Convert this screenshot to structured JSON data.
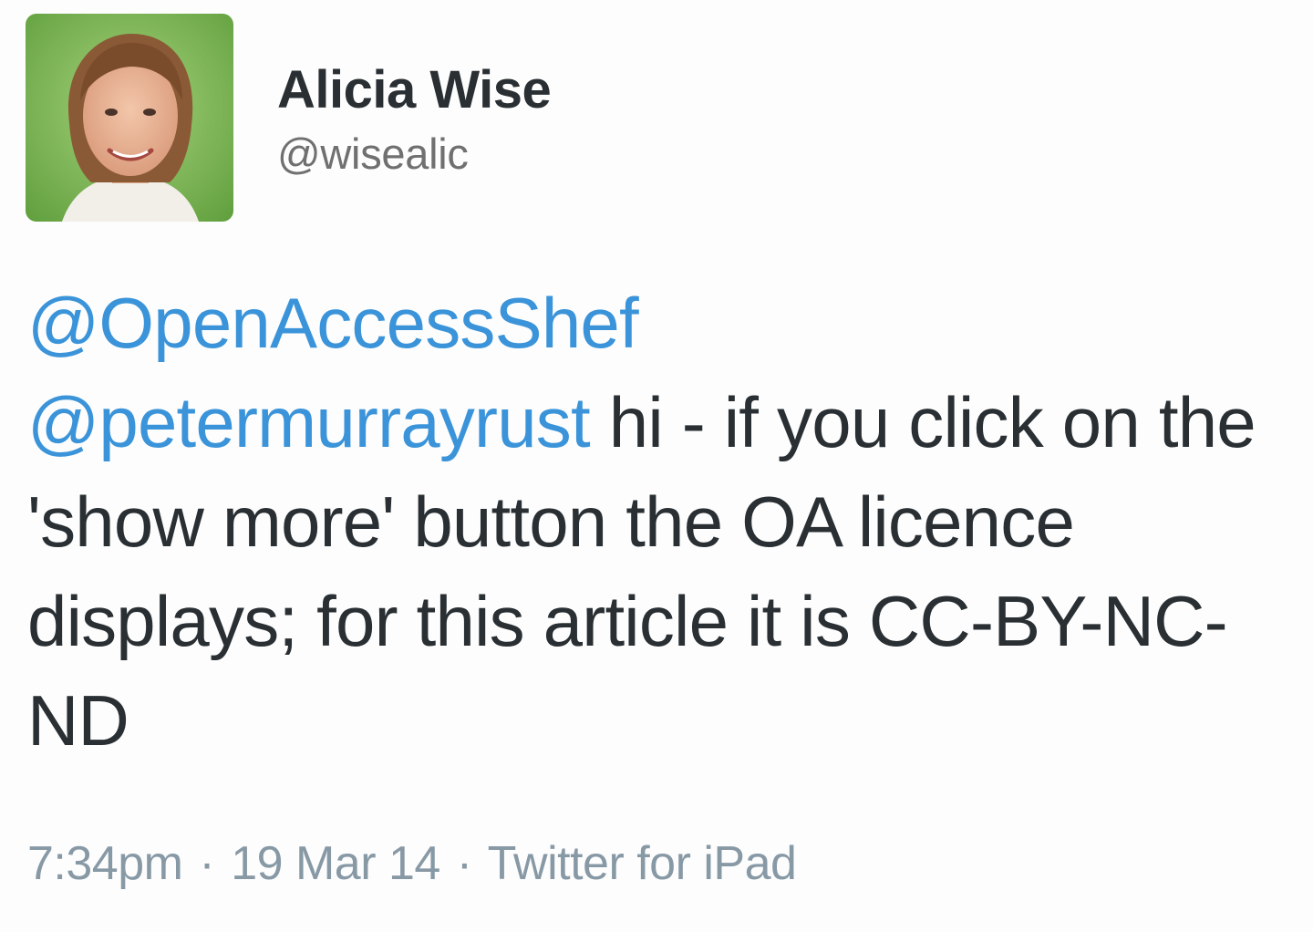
{
  "author": {
    "name": "Alicia Wise",
    "handle": "@wisealic"
  },
  "tweet": {
    "mention_1": "@OpenAccessShef",
    "mention_2": "@petermurrayrust",
    "text_1": " hi - if you click on the 'show more' button the OA licence displays; for this article it is CC-BY-NC-ND"
  },
  "meta": {
    "time": "7:34pm",
    "separator": "·",
    "date": "19 Mar 14",
    "source": "Twitter for iPad"
  },
  "colors": {
    "text": "#292f33",
    "link": "#3b94d9",
    "muted": "#8899a6"
  }
}
